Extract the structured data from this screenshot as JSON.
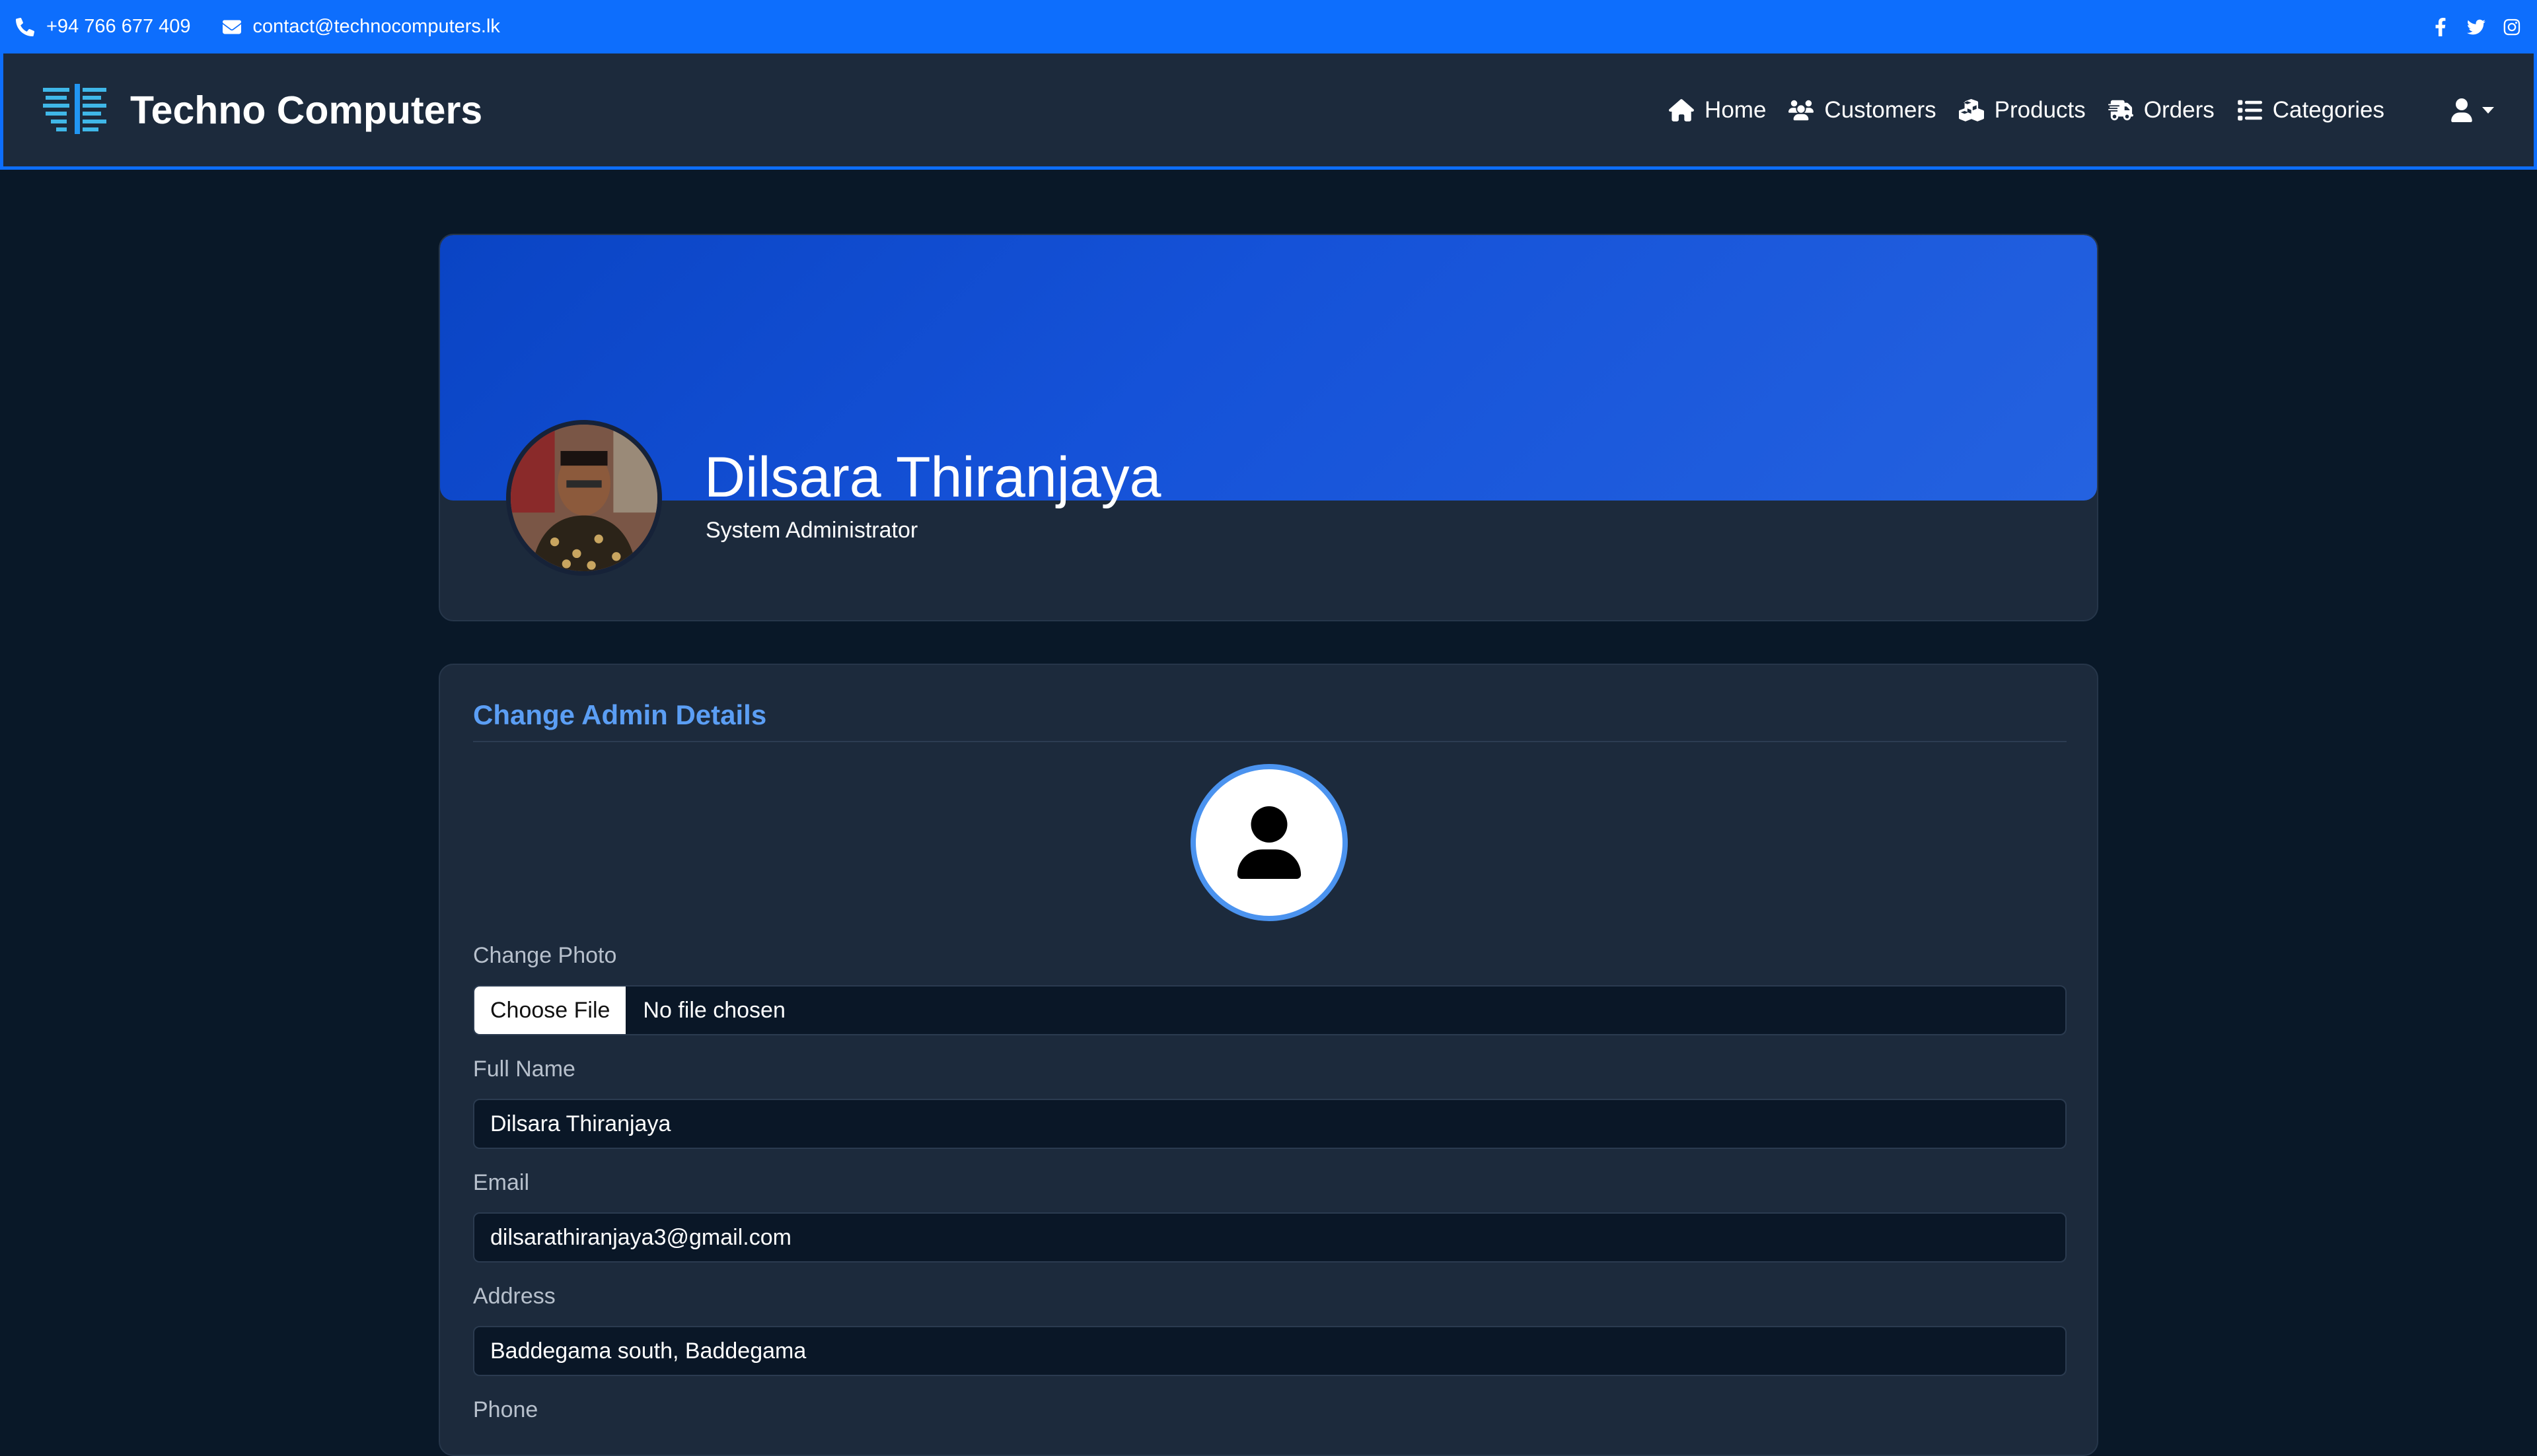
{
  "topbar": {
    "phone": "+94 766 677 409",
    "email": "contact@technocomputers.lk",
    "social": [
      "facebook-icon",
      "twitter-icon",
      "instagram-icon"
    ]
  },
  "navbar": {
    "brand": "Techno Computers",
    "links": {
      "home": "Home",
      "customers": "Customers",
      "products": "Products",
      "orders": "Orders",
      "categories": "Categories"
    }
  },
  "profile": {
    "name": "Dilsara Thiranjaya",
    "role": "System Administrator"
  },
  "details": {
    "title": "Change Admin Details",
    "photo_label": "Change Photo",
    "file_button": "Choose File",
    "file_status": "No file chosen",
    "fullname_label": "Full Name",
    "fullname_value": "Dilsara Thiranjaya",
    "email_label": "Email",
    "email_value": "dilsarathiranjaya3@gmail.com",
    "address_label": "Address",
    "address_value": "Baddegama south, Baddegama",
    "phone_label": "Phone"
  },
  "colors": {
    "accent": "#0d6efd",
    "navbar_bg": "#1c2a3c",
    "page_bg": "#091828",
    "title_blue": "#5b9ef4"
  }
}
